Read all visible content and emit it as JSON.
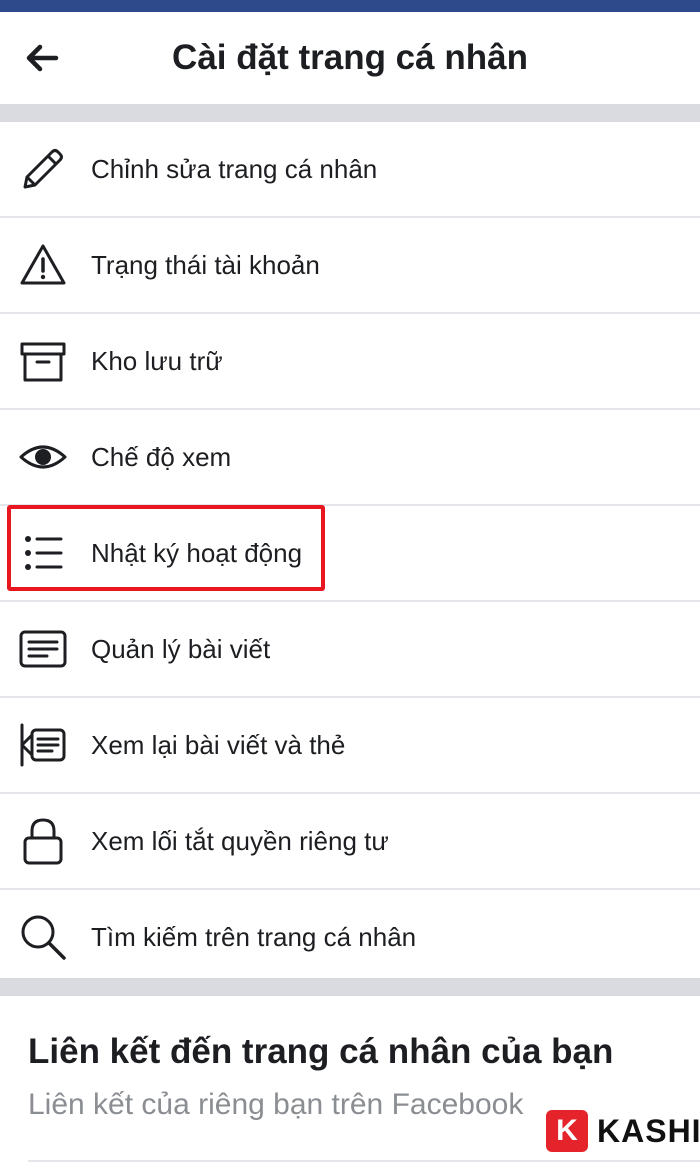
{
  "header": {
    "title": "Cài đặt trang cá nhân",
    "back_icon": "arrow-left-icon"
  },
  "menu": {
    "items": [
      {
        "label": "Chỉnh sửa trang cá nhân",
        "icon": "pencil-icon"
      },
      {
        "label": "Trạng thái tài khoản",
        "icon": "warning-icon"
      },
      {
        "label": "Kho lưu trữ",
        "icon": "archive-box-icon"
      },
      {
        "label": "Chế độ xem",
        "icon": "eye-icon"
      },
      {
        "label": "Nhật ký hoạt động",
        "icon": "list-icon",
        "highlighted": true
      },
      {
        "label": "Quản lý bài viết",
        "icon": "post-manage-icon"
      },
      {
        "label": "Xem lại bài viết và thẻ",
        "icon": "review-posts-icon"
      },
      {
        "label": "Xem lối tắt quyền riêng tư",
        "icon": "lock-icon"
      },
      {
        "label": "Tìm kiếm trên trang cá nhân",
        "icon": "search-icon"
      }
    ]
  },
  "links_section": {
    "title": "Liên kết đến trang cá nhân của bạn",
    "subtitle": "Liên kết của riêng bạn trên Facebook"
  },
  "watermark": {
    "logo_letter": "K",
    "text": "KASHI"
  },
  "colors": {
    "highlight": "#e8161e",
    "status_bar": "#2f4a8a",
    "separator": "#d9dbe0",
    "text": "#1c1e21",
    "subtitle": "#8a8d91",
    "watermark_logo": "#e5232b"
  }
}
